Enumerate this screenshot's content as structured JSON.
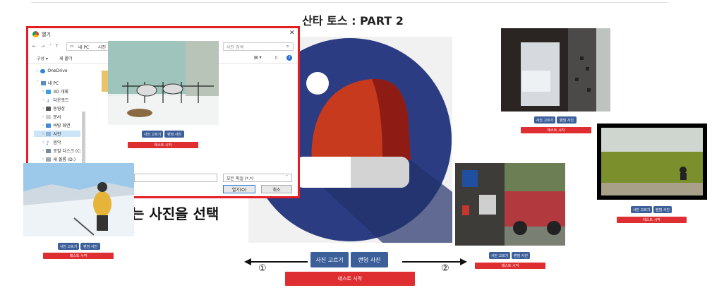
{
  "page_title": "산타 토스 : PART 2",
  "main_buttons": {
    "pick": "사진 고르기",
    "random": "랜덤 사진",
    "start": "테스트 시작"
  },
  "markers": {
    "left": "①",
    "right": "②"
  },
  "partial_heading": "는 사진을 선택",
  "dialog": {
    "title": "열기",
    "path_pc": "내 PC",
    "path_photos": "사진",
    "search_placeholder": "사진 검색",
    "organize": "구성 ▾",
    "new_folder": "새 폴더",
    "tree": [
      "OneDrive",
      "내 PC",
      "3D 개체",
      "다운로드",
      "동영상",
      "문서",
      "바탕 화면",
      "사진",
      "음악",
      "로컬 디스크 (C:)",
      "새 볼륨 (D:)"
    ],
    "file_type": "모든 파일 (*.*)",
    "open_button": "열기(O)",
    "cancel_button": "취소"
  },
  "mini_cards": {
    "pick": "사진 고르기",
    "random": "랜덤 사진",
    "start": "테스트 시작"
  },
  "colors": {
    "accent_blue": "#3c5f9a",
    "start_red": "#df2e31",
    "dialog_border": "#e31e24",
    "logo_navy": "#2b3c82",
    "logo_red": "#c83a1e"
  }
}
